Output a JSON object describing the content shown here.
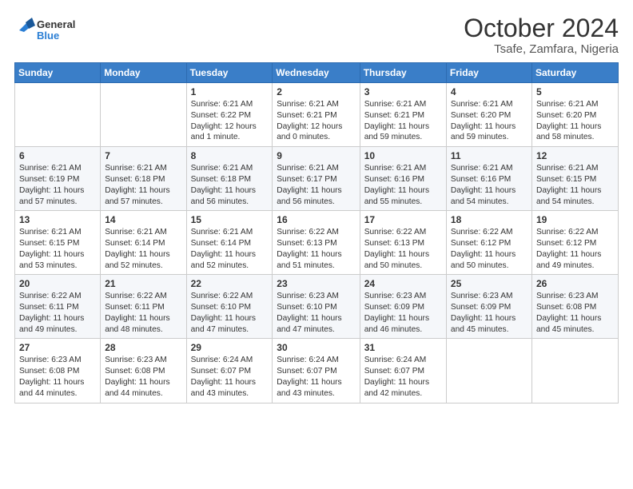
{
  "logo": {
    "text_general": "General",
    "text_blue": "Blue"
  },
  "title": "October 2024",
  "subtitle": "Tsafe, Zamfara, Nigeria",
  "days_of_week": [
    "Sunday",
    "Monday",
    "Tuesday",
    "Wednesday",
    "Thursday",
    "Friday",
    "Saturday"
  ],
  "weeks": [
    [
      {
        "day": "",
        "content": ""
      },
      {
        "day": "",
        "content": ""
      },
      {
        "day": "1",
        "content": "Sunrise: 6:21 AM\nSunset: 6:22 PM\nDaylight: 12 hours and 1 minute."
      },
      {
        "day": "2",
        "content": "Sunrise: 6:21 AM\nSunset: 6:21 PM\nDaylight: 12 hours and 0 minutes."
      },
      {
        "day": "3",
        "content": "Sunrise: 6:21 AM\nSunset: 6:21 PM\nDaylight: 11 hours and 59 minutes."
      },
      {
        "day": "4",
        "content": "Sunrise: 6:21 AM\nSunset: 6:20 PM\nDaylight: 11 hours and 59 minutes."
      },
      {
        "day": "5",
        "content": "Sunrise: 6:21 AM\nSunset: 6:20 PM\nDaylight: 11 hours and 58 minutes."
      }
    ],
    [
      {
        "day": "6",
        "content": "Sunrise: 6:21 AM\nSunset: 6:19 PM\nDaylight: 11 hours and 57 minutes."
      },
      {
        "day": "7",
        "content": "Sunrise: 6:21 AM\nSunset: 6:18 PM\nDaylight: 11 hours and 57 minutes."
      },
      {
        "day": "8",
        "content": "Sunrise: 6:21 AM\nSunset: 6:18 PM\nDaylight: 11 hours and 56 minutes."
      },
      {
        "day": "9",
        "content": "Sunrise: 6:21 AM\nSunset: 6:17 PM\nDaylight: 11 hours and 56 minutes."
      },
      {
        "day": "10",
        "content": "Sunrise: 6:21 AM\nSunset: 6:16 PM\nDaylight: 11 hours and 55 minutes."
      },
      {
        "day": "11",
        "content": "Sunrise: 6:21 AM\nSunset: 6:16 PM\nDaylight: 11 hours and 54 minutes."
      },
      {
        "day": "12",
        "content": "Sunrise: 6:21 AM\nSunset: 6:15 PM\nDaylight: 11 hours and 54 minutes."
      }
    ],
    [
      {
        "day": "13",
        "content": "Sunrise: 6:21 AM\nSunset: 6:15 PM\nDaylight: 11 hours and 53 minutes."
      },
      {
        "day": "14",
        "content": "Sunrise: 6:21 AM\nSunset: 6:14 PM\nDaylight: 11 hours and 52 minutes."
      },
      {
        "day": "15",
        "content": "Sunrise: 6:21 AM\nSunset: 6:14 PM\nDaylight: 11 hours and 52 minutes."
      },
      {
        "day": "16",
        "content": "Sunrise: 6:22 AM\nSunset: 6:13 PM\nDaylight: 11 hours and 51 minutes."
      },
      {
        "day": "17",
        "content": "Sunrise: 6:22 AM\nSunset: 6:13 PM\nDaylight: 11 hours and 50 minutes."
      },
      {
        "day": "18",
        "content": "Sunrise: 6:22 AM\nSunset: 6:12 PM\nDaylight: 11 hours and 50 minutes."
      },
      {
        "day": "19",
        "content": "Sunrise: 6:22 AM\nSunset: 6:12 PM\nDaylight: 11 hours and 49 minutes."
      }
    ],
    [
      {
        "day": "20",
        "content": "Sunrise: 6:22 AM\nSunset: 6:11 PM\nDaylight: 11 hours and 49 minutes."
      },
      {
        "day": "21",
        "content": "Sunrise: 6:22 AM\nSunset: 6:11 PM\nDaylight: 11 hours and 48 minutes."
      },
      {
        "day": "22",
        "content": "Sunrise: 6:22 AM\nSunset: 6:10 PM\nDaylight: 11 hours and 47 minutes."
      },
      {
        "day": "23",
        "content": "Sunrise: 6:23 AM\nSunset: 6:10 PM\nDaylight: 11 hours and 47 minutes."
      },
      {
        "day": "24",
        "content": "Sunrise: 6:23 AM\nSunset: 6:09 PM\nDaylight: 11 hours and 46 minutes."
      },
      {
        "day": "25",
        "content": "Sunrise: 6:23 AM\nSunset: 6:09 PM\nDaylight: 11 hours and 45 minutes."
      },
      {
        "day": "26",
        "content": "Sunrise: 6:23 AM\nSunset: 6:08 PM\nDaylight: 11 hours and 45 minutes."
      }
    ],
    [
      {
        "day": "27",
        "content": "Sunrise: 6:23 AM\nSunset: 6:08 PM\nDaylight: 11 hours and 44 minutes."
      },
      {
        "day": "28",
        "content": "Sunrise: 6:23 AM\nSunset: 6:08 PM\nDaylight: 11 hours and 44 minutes."
      },
      {
        "day": "29",
        "content": "Sunrise: 6:24 AM\nSunset: 6:07 PM\nDaylight: 11 hours and 43 minutes."
      },
      {
        "day": "30",
        "content": "Sunrise: 6:24 AM\nSunset: 6:07 PM\nDaylight: 11 hours and 43 minutes."
      },
      {
        "day": "31",
        "content": "Sunrise: 6:24 AM\nSunset: 6:07 PM\nDaylight: 11 hours and 42 minutes."
      },
      {
        "day": "",
        "content": ""
      },
      {
        "day": "",
        "content": ""
      }
    ]
  ]
}
